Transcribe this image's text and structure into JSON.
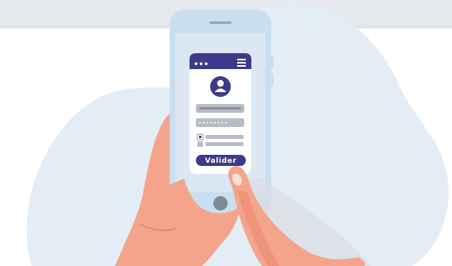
{
  "login_form": {
    "password_mask": "••••••••",
    "submit_label": "Valider",
    "menu_dots": "•••"
  },
  "colors": {
    "background_top_band": "#e6e9ee",
    "blob": "#e3edf5",
    "phone_frame": "#c9dff0",
    "app_header": "#3e3a8b",
    "accent": "#3e3a8b",
    "skin": "#f4a48b",
    "skin_shadow": "#e8876f",
    "field_grey": "#b7bcc6"
  },
  "icons": {
    "avatar": "user-avatar-icon",
    "menu": "hamburger-menu-icon",
    "checkbox": "checkbox-icon"
  }
}
